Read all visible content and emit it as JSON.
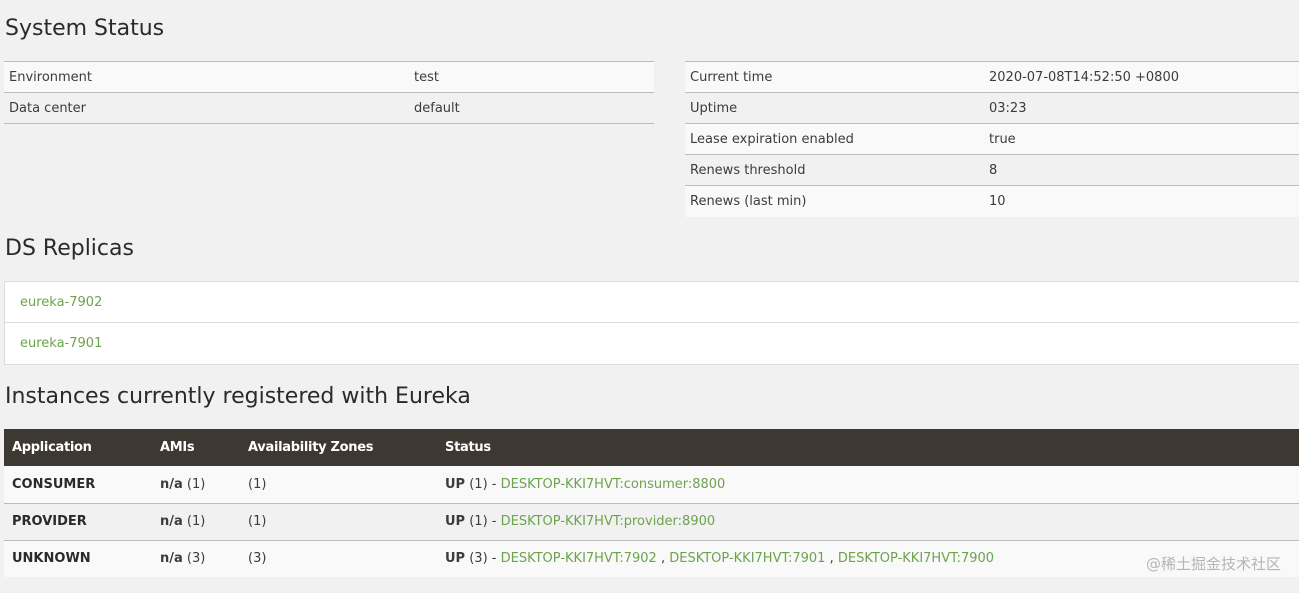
{
  "system_status": {
    "title": "System Status",
    "left": [
      {
        "label": "Environment",
        "value": "test"
      },
      {
        "label": "Data center",
        "value": "default"
      }
    ],
    "right": [
      {
        "label": "Current time",
        "value": "2020-07-08T14:52:50 +0800"
      },
      {
        "label": "Uptime",
        "value": "03:23"
      },
      {
        "label": "Lease expiration enabled",
        "value": "true"
      },
      {
        "label": "Renews threshold",
        "value": "8"
      },
      {
        "label": "Renews (last min)",
        "value": "10"
      }
    ]
  },
  "ds_replicas": {
    "title": "DS Replicas",
    "items": [
      "eureka-7902",
      "eureka-7901"
    ]
  },
  "instances": {
    "title": "Instances currently registered with Eureka",
    "columns": [
      "Application",
      "AMIs",
      "Availability Zones",
      "Status"
    ],
    "rows": [
      {
        "application": "CONSUMER",
        "amis_label": "n/a",
        "amis_count": "(1)",
        "zones": "(1)",
        "status_label": "UP",
        "status_count": "(1) - ",
        "links": [
          "DESKTOP-KKI7HVT:consumer:8800"
        ]
      },
      {
        "application": "PROVIDER",
        "amis_label": "n/a",
        "amis_count": "(1)",
        "zones": "(1)",
        "status_label": "UP",
        "status_count": "(1) - ",
        "links": [
          "DESKTOP-KKI7HVT:provider:8900"
        ]
      },
      {
        "application": "UNKNOWN",
        "amis_label": "n/a",
        "amis_count": "(3)",
        "zones": "(3)",
        "status_label": "UP",
        "status_count": "(3) - ",
        "links": [
          "DESKTOP-KKI7HVT:7902",
          "DESKTOP-KKI7HVT:7901",
          "DESKTOP-KKI7HVT:7900"
        ],
        "link_separator": " , "
      }
    ]
  },
  "watermark": "@稀土掘金技术社区"
}
